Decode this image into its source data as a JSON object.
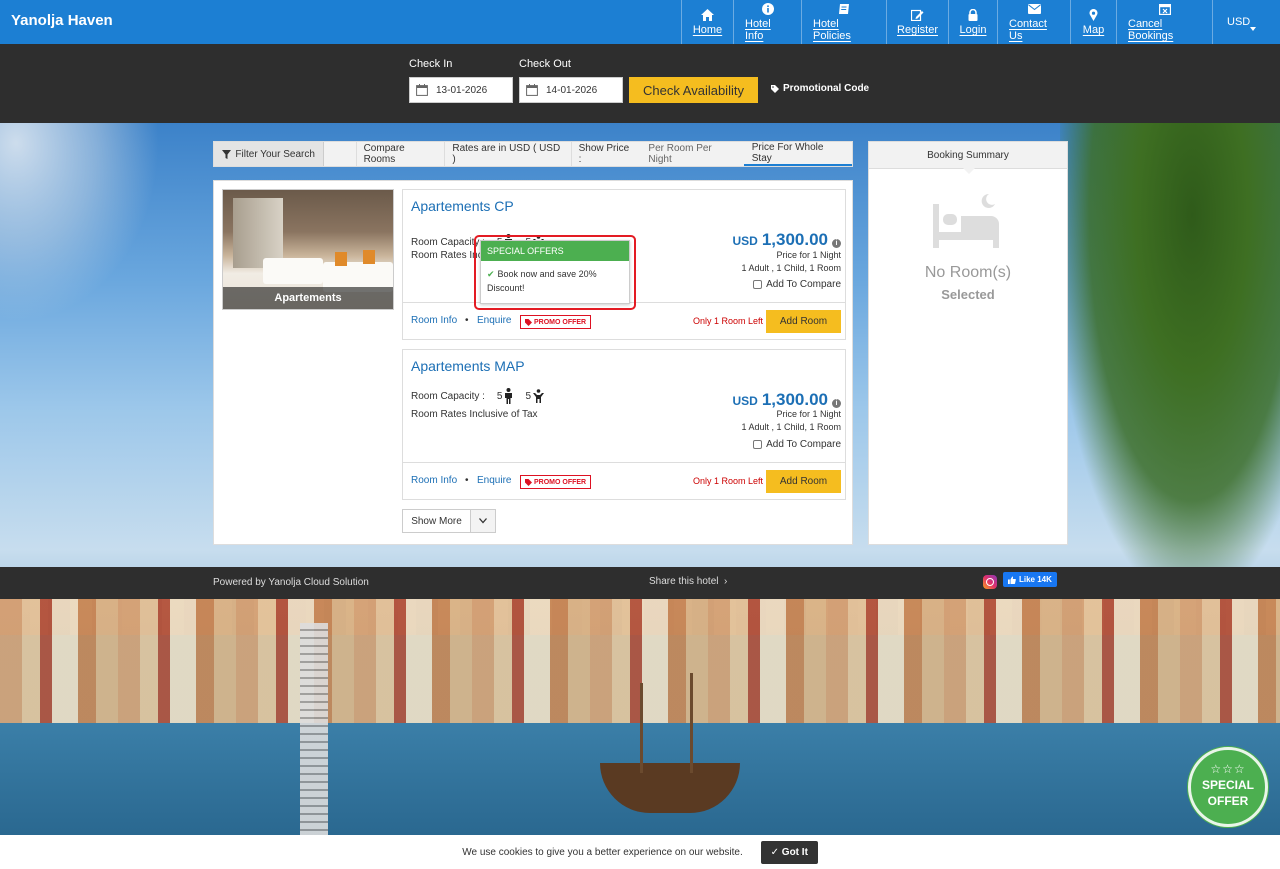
{
  "header": {
    "brand": "Yanolja Haven",
    "nav": [
      {
        "label": "Home",
        "icon": "home-icon"
      },
      {
        "label": "Hotel Info",
        "icon": "info-icon"
      },
      {
        "label": "Hotel Policies",
        "icon": "book-icon"
      },
      {
        "label": "Register",
        "icon": "edit-icon"
      },
      {
        "label": "Login",
        "icon": "lock-icon"
      },
      {
        "label": "Contact Us",
        "icon": "envelope-icon"
      },
      {
        "label": "Map",
        "icon": "map-marker-icon"
      },
      {
        "label": "Cancel Bookings",
        "icon": "calendar-x-icon"
      }
    ],
    "currency": "USD"
  },
  "search": {
    "checkin_label": "Check In",
    "checkin_value": "13-01-2026",
    "checkout_label": "Check Out",
    "checkout_value": "14-01-2026",
    "check_button": "Check Availability",
    "promo_label": "Promotional Code"
  },
  "filters": {
    "filter_button": "Filter Your Search",
    "compare_rooms": "Compare Rooms",
    "rates_note": "Rates are in USD ( USD )",
    "show_price_label": "Show Price :",
    "options": [
      "Per Room Per Night",
      "Price For Whole Stay"
    ],
    "active_option": "Price For Whole Stay"
  },
  "room_category": {
    "image_caption": "Apartements"
  },
  "rooms": [
    {
      "title": "Apartements CP",
      "capacity_label": "Room Capacity :",
      "adults": "5",
      "children": "5",
      "tax_note": "Room Rates Inclusive of Tax",
      "currency": "USD",
      "price": "1,300.00",
      "price_for": "Price for 1 Night",
      "occupancy": "1 Adult , 1 Child, 1 Room",
      "compare_label": "Add To Compare",
      "room_info": "Room Info",
      "enquire": "Enquire",
      "promo": "PROMO OFFER",
      "availability": "Only 1 Room Left",
      "add_button": "Add Room"
    },
    {
      "title": "Apartements MAP",
      "capacity_label": "Room Capacity :",
      "adults": "5",
      "children": "5",
      "tax_note": "Room Rates Inclusive of Tax",
      "currency": "USD",
      "price": "1,300.00",
      "price_for": "Price for 1 Night",
      "occupancy": "1 Adult , 1 Child, 1 Room",
      "compare_label": "Add To Compare",
      "room_info": "Room Info",
      "enquire": "Enquire",
      "promo": "PROMO OFFER",
      "availability": "Only 1 Room Left",
      "add_button": "Add Room"
    }
  ],
  "show_more": "Show More",
  "offer_popup": {
    "title": "SPECIAL OFFERS",
    "text": "Book now and save 20% Discount!"
  },
  "summary": {
    "title": "Booking Summary",
    "empty": "No Room(s)",
    "empty_sub": "Selected"
  },
  "footer": {
    "powered": "Powered by Yanolja Cloud Solution",
    "share": "Share this hotel",
    "fb_like": "Like 14K"
  },
  "special_badge": {
    "stars": "☆☆☆",
    "line1": "SPECIAL",
    "line2": "OFFER"
  },
  "cookie": {
    "text": "We use cookies to give you a better experience on our website.",
    "button": "Got It"
  },
  "colors": {
    "topbar": "#1c7fd3",
    "accent_yellow": "#f5bd1f",
    "link_blue": "#1c6fb5",
    "offer_green": "#4caf50",
    "alert_red": "#e31b23"
  }
}
